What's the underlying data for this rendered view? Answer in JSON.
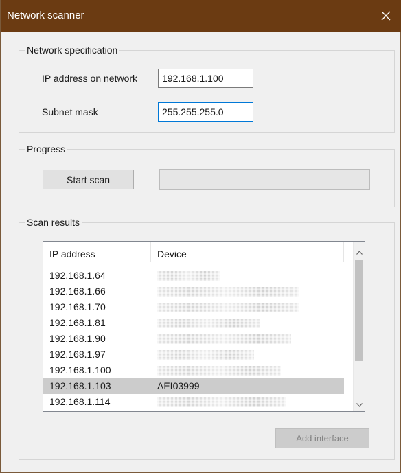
{
  "window": {
    "title": "Network scanner",
    "colors": {
      "titlebar": "#6b3b12",
      "title_text": "#ffffff",
      "window_bg": "#f0f0f0",
      "focus_border": "#0078d7",
      "selected_row": "#cccccc"
    }
  },
  "network_spec": {
    "group_label": "Network specification",
    "ip_label": "IP address on network",
    "ip_value": "192.168.1.100",
    "subnet_label": "Subnet mask",
    "subnet_value": "255.255.255.0"
  },
  "progress": {
    "group_label": "Progress",
    "start_button": "Start scan",
    "progress_value": 0
  },
  "results": {
    "group_label": "Scan results",
    "columns": [
      "IP address",
      "Device"
    ],
    "rows": [
      {
        "ip": "192.168.1.64",
        "device": "",
        "redacted": true
      },
      {
        "ip": "192.168.1.66",
        "device": "",
        "redacted": true
      },
      {
        "ip": "192.168.1.70",
        "device": "",
        "redacted": true
      },
      {
        "ip": "192.168.1.81",
        "device": "",
        "redacted": true
      },
      {
        "ip": "192.168.1.90",
        "device": "",
        "redacted": true
      },
      {
        "ip": "192.168.1.97",
        "device": "",
        "redacted": true
      },
      {
        "ip": "192.168.1.100",
        "device": "",
        "redacted": true
      },
      {
        "ip": "192.168.1.103",
        "device": "AEI03999",
        "redacted": false,
        "selected": true
      },
      {
        "ip": "192.168.1.114",
        "device": "",
        "redacted": true
      }
    ],
    "add_button": "Add interface",
    "add_button_enabled": false
  },
  "icons": {
    "close": "close-icon",
    "scroll_up": "chevron-up-icon",
    "scroll_down": "chevron-down-icon"
  }
}
